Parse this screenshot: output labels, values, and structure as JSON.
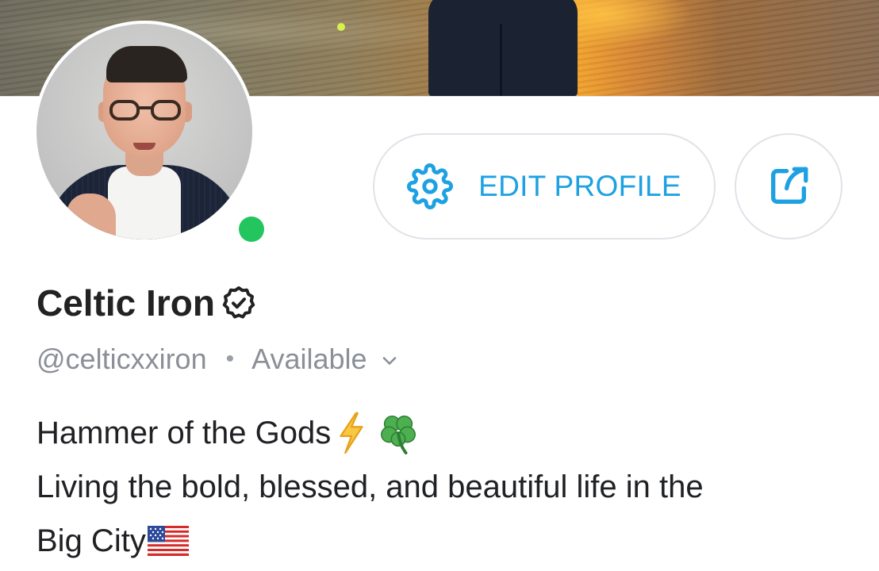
{
  "profile": {
    "display_name": "Celtic Iron",
    "handle": "@celticxxiron",
    "separator": "•",
    "availability": "Available",
    "online": true
  },
  "actions": {
    "edit_profile_label": "EDIT PROFILE",
    "edit_profile_icon": "gear-icon",
    "share_icon": "share-icon"
  },
  "bio": {
    "line1": "Hammer of the Gods",
    "line1_icons": [
      "lightning-bolt-icon",
      "four-leaf-clover-icon"
    ],
    "line2": "Living the bold, blessed, and beautiful life in the",
    "line3": "Big City",
    "line3_icons": [
      "us-flag-icon"
    ]
  },
  "colors": {
    "accent": "#1da1e2",
    "online": "#22c55e",
    "muted_text": "#8a8f98",
    "name_text": "#222222",
    "button_border": "#dfe3e8"
  }
}
